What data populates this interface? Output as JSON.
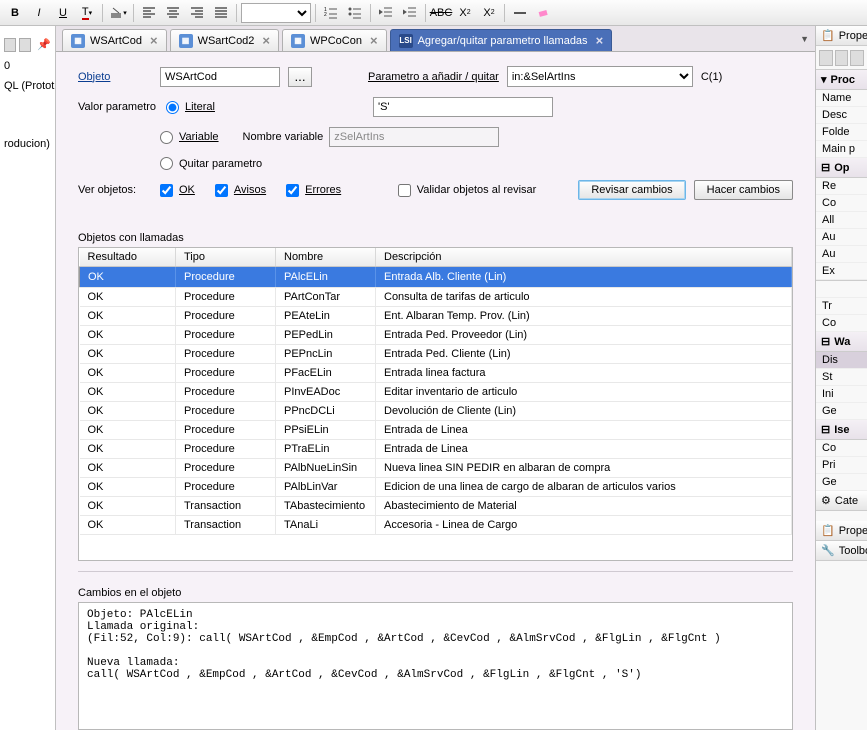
{
  "left_panel": {
    "line1": "0",
    "line2": "QL (Prototip",
    "line3": "roducion)"
  },
  "tabs": [
    {
      "label": "WSArtCod",
      "icon": "ws"
    },
    {
      "label": "WSartCod2",
      "icon": "ws"
    },
    {
      "label": "WPCoCon",
      "icon": "ws"
    },
    {
      "label": "Agregar/quitar parametro llamadas",
      "icon": "lsi",
      "active": true
    }
  ],
  "form": {
    "objeto_label": "Objeto",
    "objeto_value": "WSArtCod",
    "param_label": "Parametro a añadir / quitar",
    "param_value": "in:&SelArtIns",
    "count": "C(1)",
    "valor_label": "Valor parametro",
    "opt_literal": "Literal",
    "opt_variable": "Variable",
    "opt_quitar": "Quitar parametro",
    "literal_value": "'S'",
    "nombre_var_label": "Nombre variable",
    "nombre_var_value": "zSelArtIns",
    "ver_label": "Ver objetos:",
    "chk_ok": "OK",
    "chk_avisos": "Avisos",
    "chk_errores": "Errores",
    "chk_validar": "Validar objetos al revisar",
    "btn_revisar": "Revisar cambios",
    "btn_hacer": "Hacer cambios"
  },
  "table": {
    "title": "Objetos con llamadas",
    "headers": [
      "Resultado",
      "Tipo",
      "Nombre",
      "Descripción"
    ],
    "rows": [
      [
        "OK",
        "Procedure",
        "PAlcELin",
        "Entrada Alb. Cliente (Lin)"
      ],
      [
        "OK",
        "Procedure",
        "PArtConTar",
        "Consulta de tarifas de articulo"
      ],
      [
        "OK",
        "Procedure",
        "PEAteLin",
        "Ent. Albaran Temp. Prov. (Lin)"
      ],
      [
        "OK",
        "Procedure",
        "PEPedLin",
        "Entrada Ped. Proveedor (Lin)"
      ],
      [
        "OK",
        "Procedure",
        "PEPncLin",
        "Entrada Ped. Cliente (Lin)"
      ],
      [
        "OK",
        "Procedure",
        "PFacELin",
        "Entrada linea factura"
      ],
      [
        "OK",
        "Procedure",
        "PInvEADoc",
        "Editar inventario de articulo"
      ],
      [
        "OK",
        "Procedure",
        "PPncDCLi",
        "Devolución de Cliente (Lin)"
      ],
      [
        "OK",
        "Procedure",
        "PPsiELin",
        "Entrada de Linea"
      ],
      [
        "OK",
        "Procedure",
        "PTraELin",
        "Entrada de Linea"
      ],
      [
        "OK",
        "Procedure",
        "PAlbNueLinSin",
        "Nueva linea SIN PEDIR en albaran de compra"
      ],
      [
        "OK",
        "Procedure",
        "PAlbLinVar",
        "Edicion de una linea de cargo de albaran de articulos varios"
      ],
      [
        "OK",
        "Transaction",
        "TAbastecimiento",
        "Abastecimiento de Material"
      ],
      [
        "OK",
        "Transaction",
        "TAnaLi",
        "Accesoria - Linea de Cargo"
      ]
    ]
  },
  "output": {
    "title": "Cambios en el objeto",
    "text": "Objeto: PAlcELin\nLlamada original:\n(Fil:52, Col:9): call( WSArtCod , &EmpCod , &ArtCod , &CevCod , &AlmSrvCod , &FlgLin , &FlgCnt )\n\nNueva llamada:\ncall( WSArtCod , &EmpCod , &ArtCod , &CevCod , &AlmSrvCod , &FlgLin , &FlgCnt , 'S')"
  },
  "right": {
    "properties": "Propert",
    "proc": "Proc",
    "items1": [
      "Name",
      "Desc",
      "Folde",
      "Main p"
    ],
    "op": "Op",
    "items2": [
      "Re",
      "Co",
      "All",
      "Au",
      "Au",
      "Ex"
    ],
    "sep1": "",
    "items3": [
      "Tr",
      "Co"
    ],
    "wa": "Wa",
    "items4": [
      "Dis",
      "St",
      "Ini",
      "Ge"
    ],
    "ise": "Ise",
    "items5": [
      "Co",
      "Pri",
      "Ge"
    ],
    "cat": "Cate",
    "prop2": "Prope",
    "toolbox": "Toolbo"
  }
}
